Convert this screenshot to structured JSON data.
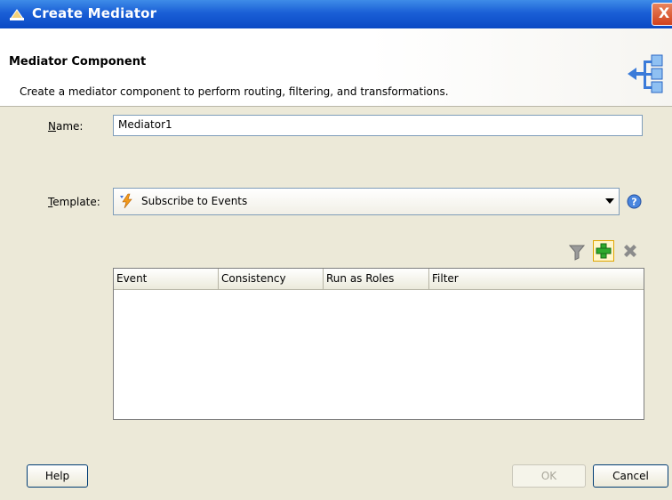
{
  "window": {
    "title": "Create Mediator",
    "close_glyph": "X"
  },
  "header": {
    "title": "Mediator Component",
    "description": "Create a mediator component to perform routing, filtering, and transformations.",
    "icon": "mediator-component-icon"
  },
  "form": {
    "name_label_mnemonic": "N",
    "name_label_rest": "ame:",
    "name_value": "Mediator1",
    "template_label_mnemonic": "T",
    "template_label_rest": "emplate:",
    "template_value": "Subscribe to Events",
    "template_icon": "event-lightning-icon"
  },
  "toolbar": {
    "filter_icon": "filter-icon",
    "add_icon": "add-icon",
    "delete_icon": "delete-icon"
  },
  "table": {
    "columns": [
      "Event",
      "Consistency",
      "Run as Roles",
      "Filter"
    ],
    "rows": []
  },
  "buttons": {
    "help": "Help",
    "ok": "OK",
    "cancel": "Cancel"
  },
  "colors": {
    "title_bar": "#1a5fd6",
    "dialog_bg": "#ece9d8",
    "add_highlight": "#e0a500"
  }
}
